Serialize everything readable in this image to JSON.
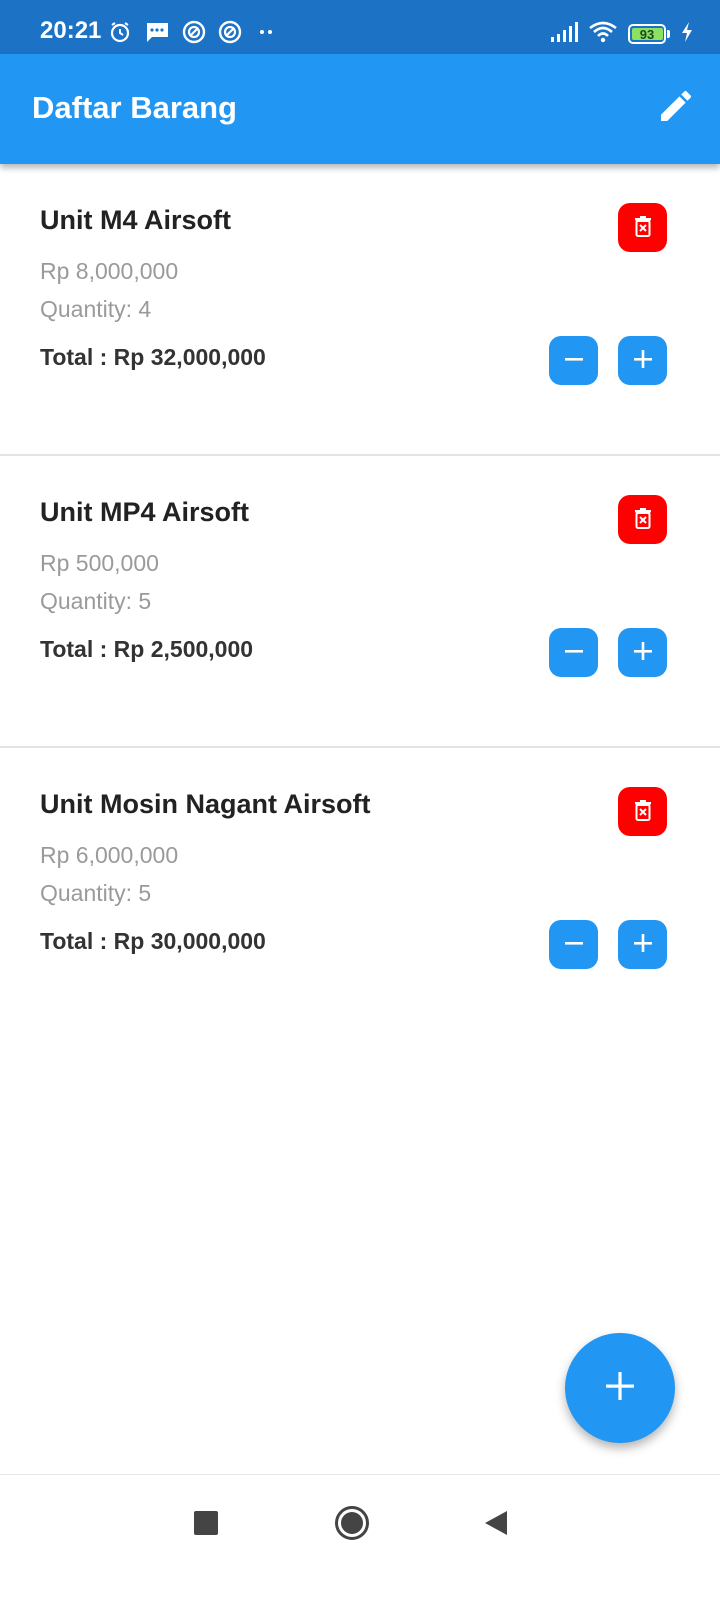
{
  "status_bar": {
    "time": "20:21",
    "battery_level": "93",
    "left_icons": [
      "alarm-icon",
      "message-icon",
      "vpn-icon",
      "vpn-icon",
      "more-dots-icon"
    ],
    "right_icons": [
      "signal-icon",
      "wifi-icon",
      "battery-icon",
      "charging-icon"
    ]
  },
  "app_bar": {
    "title": "Daftar Barang",
    "action_icon": "edit-icon"
  },
  "items": [
    {
      "name": "Unit M4 Airsoft",
      "price": "Rp 8,000,000",
      "quantity": "Quantity: 4",
      "total": "Total : Rp 32,000,000"
    },
    {
      "name": "Unit MP4 Airsoft",
      "price": "Rp 500,000",
      "quantity": "Quantity: 5",
      "total": "Total : Rp 2,500,000"
    },
    {
      "name": "Unit Mosin Nagant Airsoft",
      "price": "Rp 6,000,000",
      "quantity": "Quantity: 5",
      "total": "Total : Rp 30,000,000"
    }
  ],
  "fab": {
    "icon": "add-icon"
  },
  "nav_bar": {
    "icons": [
      "recents-icon",
      "home-icon",
      "back-icon"
    ]
  },
  "colors": {
    "status_bar": "#1c72c4",
    "primary": "#2196f3",
    "delete": "#ff0000",
    "title_text": "#222222",
    "secondary_text": "#9a9a9a"
  }
}
